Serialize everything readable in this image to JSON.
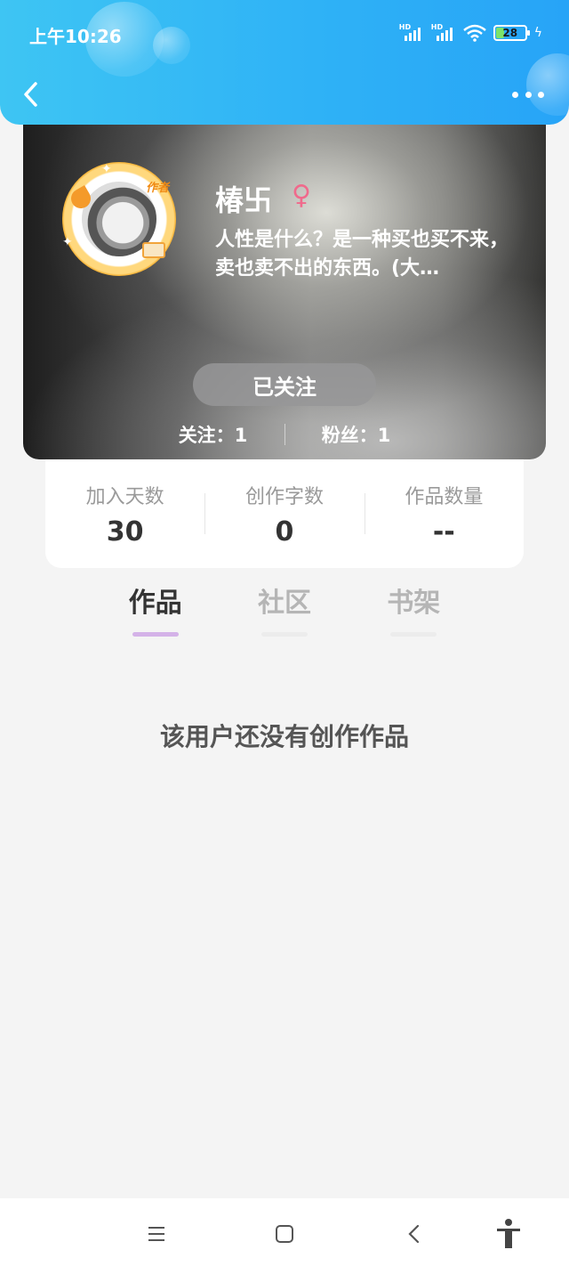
{
  "status_bar": {
    "time": "上午10:26",
    "network_1": "HD",
    "network_2": "HD",
    "battery": "28"
  },
  "header": {
    "back_icon": "chevron-left-icon",
    "more_icon": "more-dots-icon"
  },
  "profile": {
    "avatar_badge": "作者",
    "username": "椿卐",
    "gender_symbol": "♀",
    "bio": "人性是什么？是一种买也买不来，卖也卖不出的东西。(大…",
    "follow_button": "已关注",
    "following": "关注：1",
    "followers": "粉丝：1"
  },
  "stats": [
    {
      "label": "加入天数",
      "value": "30"
    },
    {
      "label": "创作字数",
      "value": "0"
    },
    {
      "label": "作品数量",
      "value": "--"
    }
  ],
  "tabs": [
    {
      "label": "作品",
      "active": true
    },
    {
      "label": "社区",
      "active": false
    },
    {
      "label": "书架",
      "active": false
    }
  ],
  "empty_state": "该用户还没有创作作品",
  "colors": {
    "header_blue": "#2fb2f6",
    "tab_indicator": "#d4b2e8",
    "gender_pink": "#f06a8c"
  },
  "bottom_nav": [
    "menu-icon",
    "home-square-icon",
    "back-chevron-icon",
    "accessibility-icon"
  ]
}
